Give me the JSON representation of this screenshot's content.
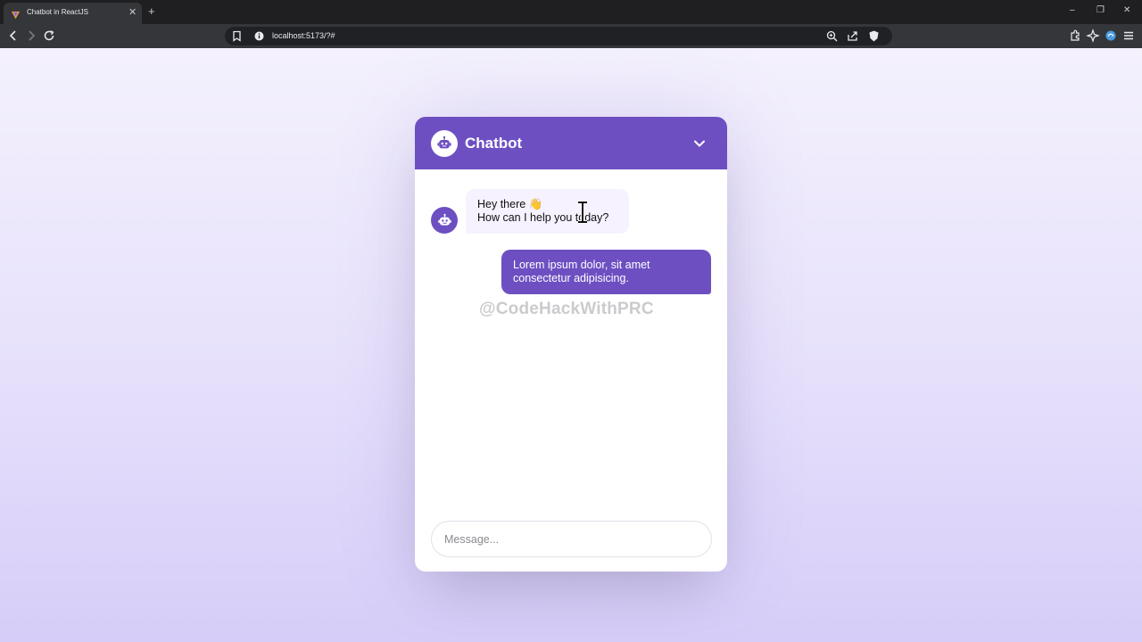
{
  "browser": {
    "tab_title": "Chatbot in ReactJS",
    "tab_close": "✕",
    "new_tab": "+",
    "address": "localhost:5173/?#",
    "window_controls": {
      "minimize": "–",
      "restore": "❐",
      "close": "✕"
    }
  },
  "chatbot": {
    "title": "Chatbot",
    "messages": [
      {
        "role": "bot",
        "lines": [
          "Hey there 👋",
          "How can I help you today?"
        ]
      },
      {
        "role": "user",
        "text": "Lorem ipsum dolor, sit amet consectetur adipisicing."
      }
    ],
    "input_placeholder": "Message..."
  },
  "watermark": "@CodeHackWithPRC",
  "colors": {
    "primary": "#6d4fc2",
    "bot_bubble": "#f6f2ff",
    "page_bg_top": "#f4f1fd",
    "page_bg_bottom": "#d6cdf8"
  }
}
